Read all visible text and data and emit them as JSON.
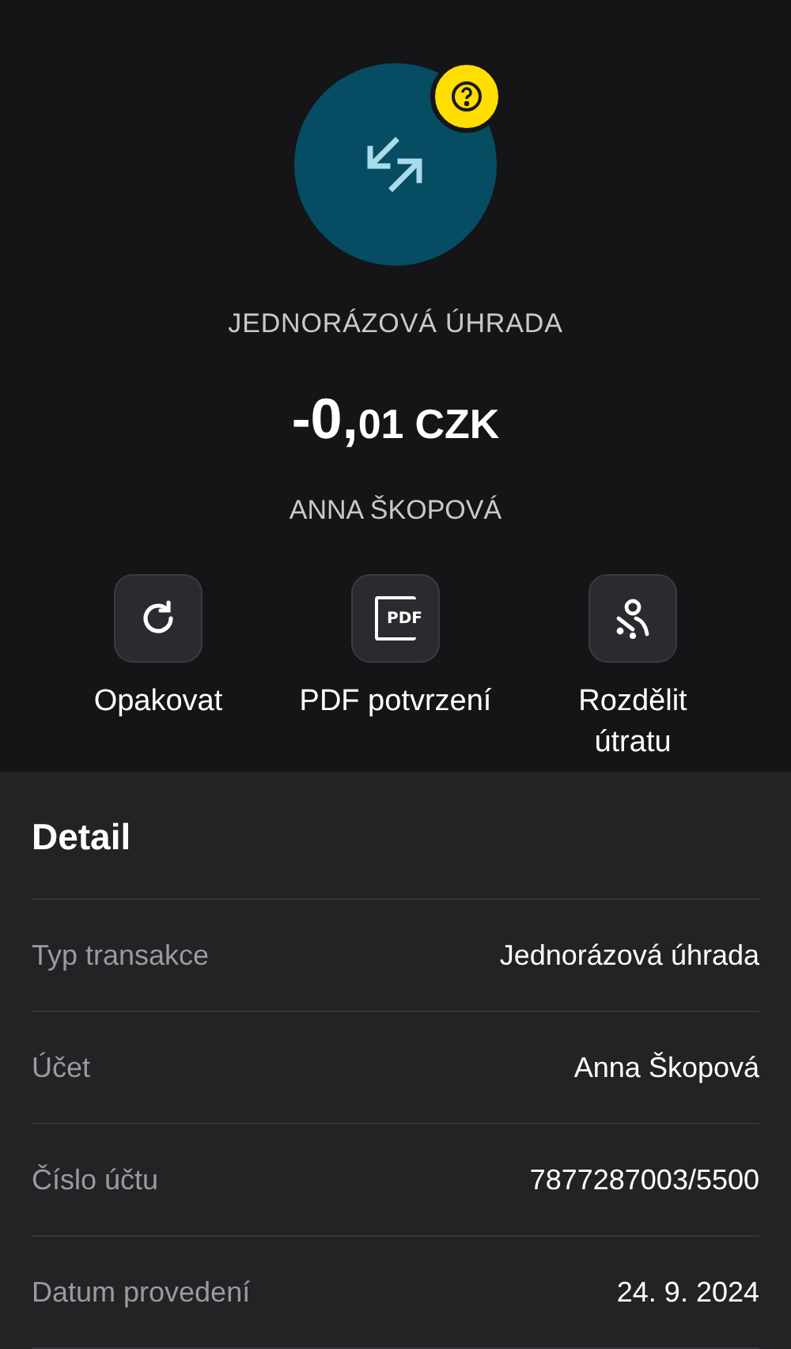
{
  "header": {
    "type": "JEDNORÁZOVÁ ÚHRADA",
    "amount_main": "-0,",
    "amount_fraction": "01",
    "currency": "CZK",
    "counterparty": "ANNA ŠKOPOVÁ"
  },
  "actions": [
    {
      "kind": "repeat",
      "label": "Opakovat"
    },
    {
      "kind": "pdf",
      "label": "PDF potvrzení",
      "icon_text": "PDF"
    },
    {
      "kind": "split",
      "label": "Rozdělit útratu"
    }
  ],
  "detail": {
    "title": "Detail",
    "rows": [
      {
        "label": "Typ transakce",
        "value": "Jednorázová úhrada"
      },
      {
        "label": "Účet",
        "value": "Anna Škopová"
      },
      {
        "label": "Číslo účtu",
        "value": "7877287003/5500"
      },
      {
        "label": "Datum provedení",
        "value": "24. 9. 2024"
      }
    ]
  }
}
